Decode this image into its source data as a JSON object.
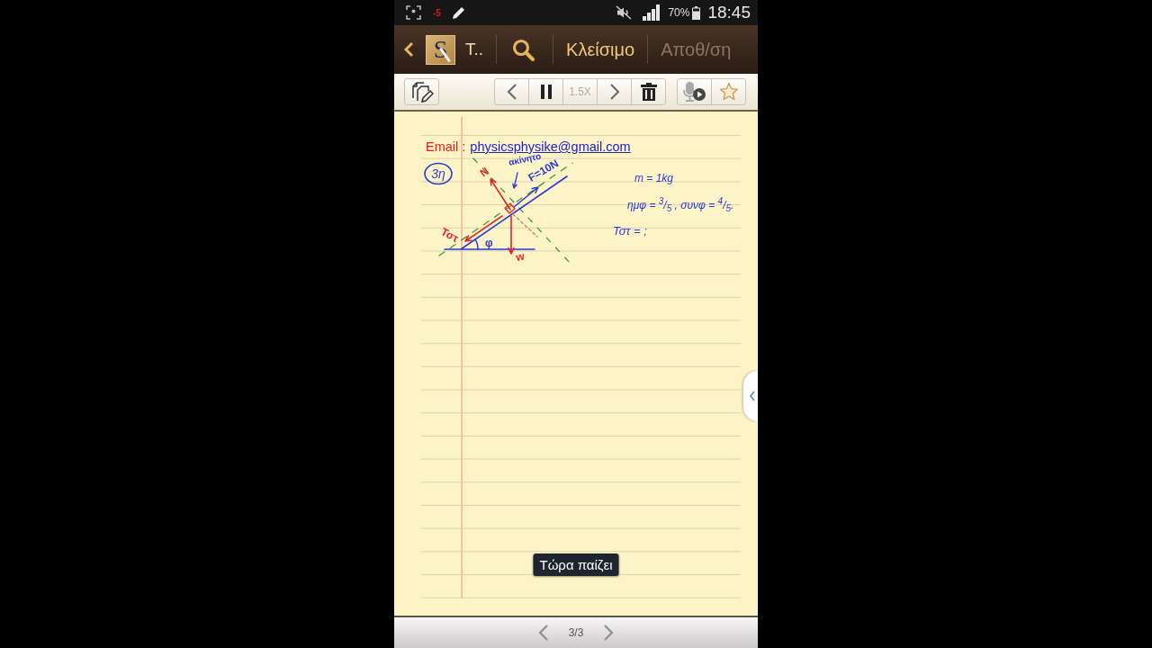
{
  "status_bar": {
    "notice": "-5",
    "battery": "70%",
    "time": "18:45"
  },
  "app_bar": {
    "logo_letter": "S",
    "title": "T..",
    "actions": [
      {
        "label": "Κλείσιμο",
        "disabled": false
      },
      {
        "label": "Αποθ/ση",
        "disabled": true
      }
    ]
  },
  "toolbar": {
    "groups": [
      {
        "buttons": [
          {
            "kind": "edit-pages",
            "disabled": false
          }
        ]
      },
      {
        "buttons": [
          {
            "kind": "previous",
            "disabled": false
          },
          {
            "kind": "pause",
            "disabled": false
          },
          {
            "kind": "speed",
            "label": "1.5X",
            "disabled": true
          },
          {
            "kind": "next",
            "disabled": false
          },
          {
            "kind": "delete",
            "disabled": false
          }
        ]
      },
      {
        "buttons": [
          {
            "kind": "voice-play",
            "disabled": false
          },
          {
            "kind": "favorite",
            "disabled": false
          }
        ]
      }
    ]
  },
  "note": {
    "email_label": "Email :",
    "email": "physicsphysike@gmail.com",
    "exercise_number": "3η",
    "diagram_labels": [
      {
        "text": "N",
        "color": "#e02828"
      },
      {
        "text": "ακίνητο",
        "color": "#2a3ad8"
      },
      {
        "text": "F=10N",
        "color": "#2a3ad8"
      },
      {
        "text": "Τστ",
        "color": "#e02828"
      },
      {
        "text": "φ",
        "color": "#2a3ad8"
      },
      {
        "text": "w",
        "color": "#e02828"
      }
    ],
    "notes": [
      "m = 1kg",
      "ημφ = $^{3}$/$_{5}$ , συνφ = $^{4}$/$_{5}$.",
      "Τστ = ;"
    ]
  },
  "toast": "Τώρα παίζει",
  "pager": {
    "page": "3/3"
  }
}
